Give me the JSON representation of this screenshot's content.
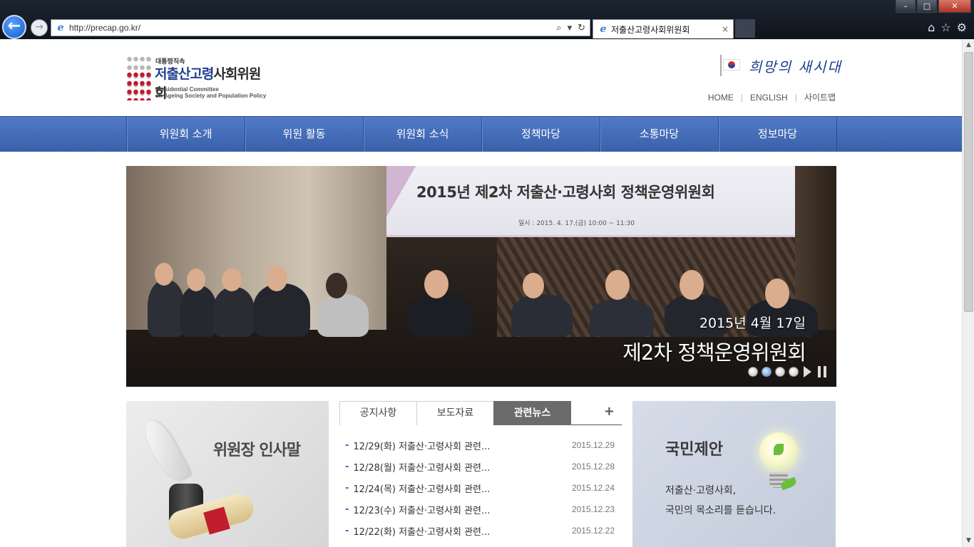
{
  "browser": {
    "url": "http://precap.go.kr/",
    "tab_title": "저출산고령사회위원회",
    "tab_close": "×",
    "window_controls": [
      "minimize",
      "maximize",
      "close"
    ],
    "icons": [
      "back-icon",
      "forward-icon",
      "search-icon",
      "refresh-icon",
      "home-icon",
      "favorites-icon",
      "settings-icon"
    ]
  },
  "header": {
    "logo_small": "대통령직속",
    "logo_main_1": "저출산고령",
    "logo_main_2": "사회위원회",
    "logo_en_1": "Presidential Committee",
    "logo_en_2": "on Ageing Society and Population Policy",
    "slogan": "희망의 새시대",
    "links": [
      "HOME",
      "ENGLISH",
      "사이트맵"
    ]
  },
  "nav": {
    "items": [
      "위원회 소개",
      "위원 활동",
      "위원회 소식",
      "정책마당",
      "소통마당",
      "정보마당"
    ]
  },
  "hero": {
    "banner_title": "2015년 제2차 저출산·고령사회 정책운영위원회",
    "banner_sub": "일시 : 2015. 4. 17.(금) 10:00 ~ 11:30",
    "caption_date": "2015년 4월 17일",
    "caption_event": "제2차 정책운영위원회",
    "slides": 4,
    "active_slide": 2
  },
  "greeting": {
    "title": "위원장 인사말"
  },
  "news": {
    "tabs": [
      "공지사항",
      "보도자료",
      "관련뉴스"
    ],
    "active_tab": "관련뉴스",
    "more": "+",
    "items": [
      {
        "title": "12/29(화) 저출산·고령사회 관련...",
        "date": "2015.12.29"
      },
      {
        "title": "12/28(월) 저출산·고령사회 관련...",
        "date": "2015.12.28"
      },
      {
        "title": "12/24(목) 저출산·고령사회 관련...",
        "date": "2015.12.24"
      },
      {
        "title": "12/23(수) 저출산·고령사회 관련...",
        "date": "2015.12.23"
      },
      {
        "title": "12/22(화) 저출산·고령사회 관련...",
        "date": "2015.12.22"
      }
    ]
  },
  "proposal": {
    "title": "국민제안",
    "desc_1": "저출산·고령사회,",
    "desc_2": "국민의 목소리를 듣습니다."
  },
  "colors": {
    "nav": "#3f67b6",
    "accent_blue": "#3d8ee6",
    "logo_red": "#c8172e"
  }
}
